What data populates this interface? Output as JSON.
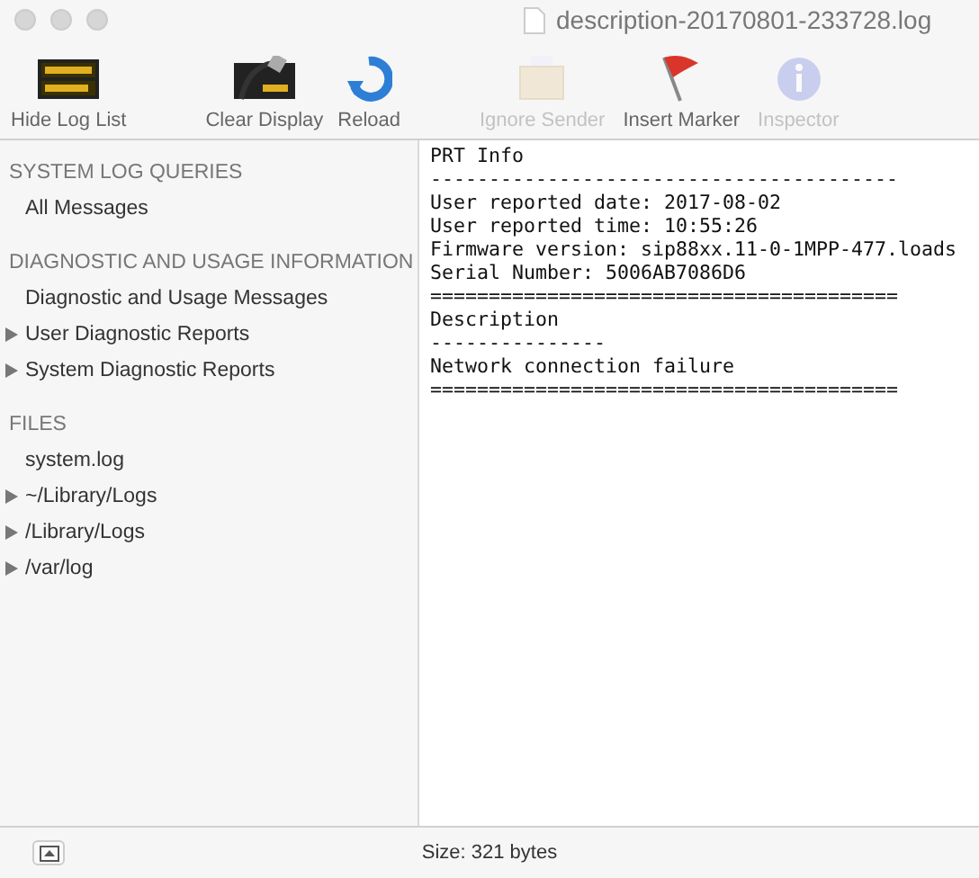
{
  "window": {
    "title": "description-20170801-233728.log"
  },
  "toolbar": [
    {
      "label": "Hide Log List",
      "kind": "warning-sign",
      "disabled": false
    },
    {
      "label": "Clear Display",
      "kind": "clear-sign",
      "disabled": false
    },
    {
      "label": "Reload",
      "kind": "reload",
      "disabled": false
    },
    {
      "label": "Ignore Sender",
      "kind": "box",
      "disabled": true
    },
    {
      "label": "Insert Marker",
      "kind": "flag",
      "disabled": false
    },
    {
      "label": "Inspector",
      "kind": "info",
      "disabled": true
    }
  ],
  "sidebar": {
    "sections": [
      {
        "title": "SYSTEM LOG QUERIES",
        "items": [
          {
            "label": "All Messages",
            "kind": "plain"
          }
        ]
      },
      {
        "title": "DIAGNOSTIC AND USAGE INFORMATION",
        "items": [
          {
            "label": "Diagnostic and Usage Messages",
            "kind": "plain"
          },
          {
            "label": "User Diagnostic Reports",
            "kind": "folder"
          },
          {
            "label": "System Diagnostic Reports",
            "kind": "folder"
          }
        ]
      },
      {
        "title": "FILES",
        "items": [
          {
            "label": "system.log",
            "kind": "plain"
          },
          {
            "label": "~/Library/Logs",
            "kind": "folder"
          },
          {
            "label": "/Library/Logs",
            "kind": "folder"
          },
          {
            "label": "/var/log",
            "kind": "folder"
          }
        ]
      }
    ]
  },
  "log_lines": [
    "PRT Info",
    "----------------------------------------",
    "User reported date: 2017-08-02",
    "User reported time: 10:55:26",
    "Firmware version: sip88xx.11-0-1MPP-477.loads",
    "Serial Number: 5006AB7086D6",
    "========================================",
    "Description",
    "---------------",
    "Network connection failure",
    "========================================"
  ],
  "status_bar": {
    "text": "Size: 321 bytes"
  }
}
